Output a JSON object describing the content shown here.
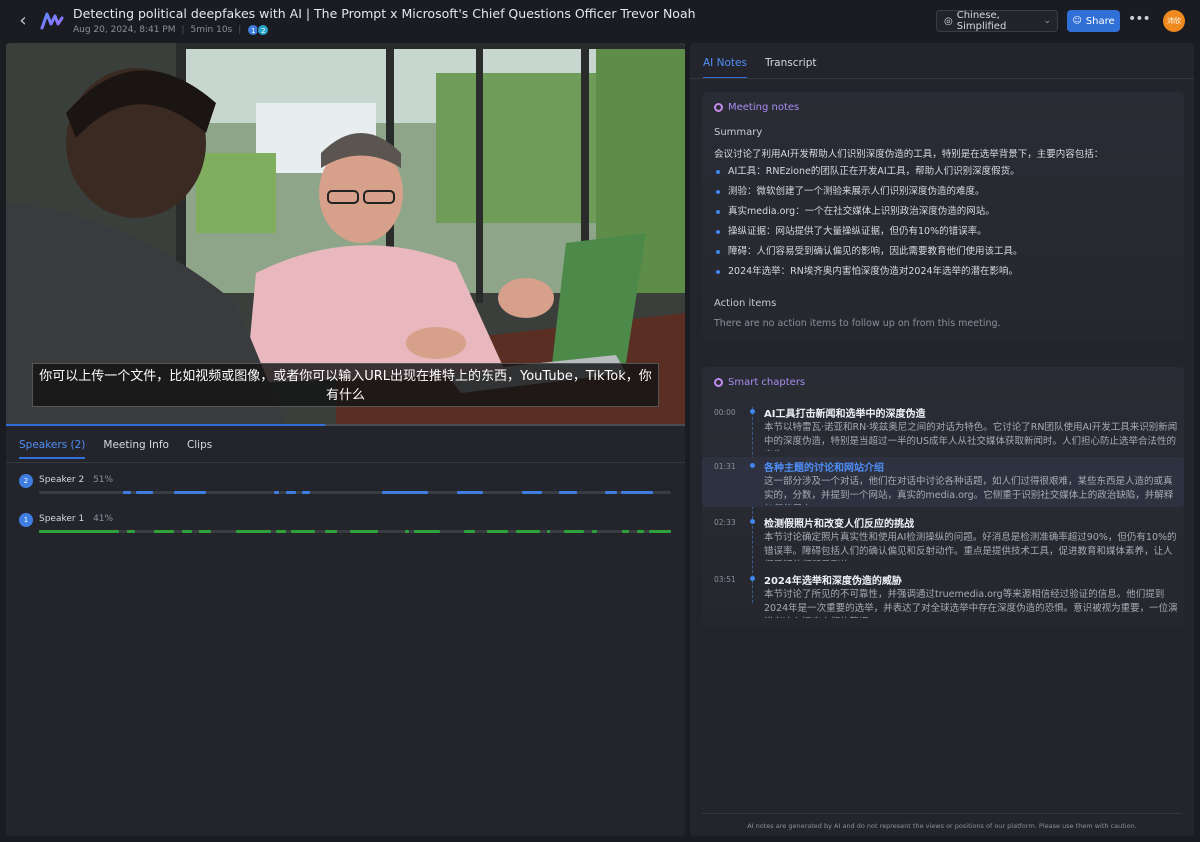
{
  "header": {
    "title": "Detecting political deepfakes with AI | The Prompt x Microsoft's Chief Questions Officer Trevor Noah",
    "date": "Aug 20, 2024, 8:41 PM",
    "duration": "5min 10s",
    "participants": [
      "1",
      "2"
    ],
    "language": "Chinese, Simplified",
    "share_label": "Share",
    "user_initials": "沛欣"
  },
  "video": {
    "subtitle": "你可以上传一个文件，比如视频或图像，或者你可以输入URL出现在推特上的东西，YouTube，TikTok，你有什么",
    "progress_fraction": 0.47
  },
  "left_tabs": [
    "Speakers (2)",
    "Meeting Info",
    "Clips"
  ],
  "speakers": [
    {
      "id": "2",
      "name": "Speaker 2",
      "pct": "51%",
      "color": "#3f7de0"
    },
    {
      "id": "1",
      "name": "Speaker 1",
      "pct": "41%",
      "color": "#2fa33a"
    }
  ],
  "right_tabs": [
    "AI Notes",
    "Transcript"
  ],
  "meeting_notes": {
    "header": "Meeting notes",
    "summary_title": "Summary",
    "summary_intro": "会议讨论了利用AI开发帮助人们识别深度伪造的工具，特别是在选举背景下，主要内容包括：",
    "bullets": [
      "AI工具：RNEzione的团队正在开发AI工具，帮助人们识别深度假货。",
      "测验：微软创建了一个测验来展示人们识别深度伪造的难度。",
      "真实media.org：一个在社交媒体上识别政治深度伪造的网站。",
      "操纵证据：网站提供了大量操纵证据，但仍有10%的错误率。",
      "障碍：人们容易受到确认偏见的影响，因此需要教育他们使用该工具。",
      "2024年选举：RN埃齐奥内害怕深度伪造对2024年选举的潜在影响。"
    ],
    "action_items_title": "Action items",
    "action_items_empty": "There are no action items to follow up on from this meeting."
  },
  "smart_chapters": {
    "header": "Smart chapters",
    "chapters": [
      {
        "time": "00:00",
        "title": "AI工具打击新闻和选举中的深度伪造",
        "desc": "本节以特雷瓦·诺亚和RN·埃兹奥尼之间的对话为特色。它讨论了RN团队使用AI开发工具来识别新闻中的深度伪造，特别是当超过一半的US成年人从社交媒体获取新闻时。人们担心防止选举合法性的丧失。"
      },
      {
        "time": "01:31",
        "title": "各种主题的讨论和网站介绍",
        "desc": "这一部分涉及一个对话，他们在对话中讨论各种话题，如人们过得很艰难，某些东西是人造的或真实的，分数，并提到一个网站，真实的media.org。它侧重于识别社交媒体上的政治缺陷，并解释如何使用它。"
      },
      {
        "time": "02:33",
        "title": "检测假照片和改变人们反应的挑战",
        "desc": "本节讨论确定照片真实性和使用AI检测操纵的问题。好消息是检测准确率超过90%，但仍有10%的错误率。障碍包括人们的确认偏见和反射动作。重点是提供技术工具，促进教育和媒体素养，让人们质疑他们所看到的。"
      },
      {
        "time": "03:51",
        "title": "2024年选举和深度伪造的威胁",
        "desc": "本节讨论了所见的不可靠性，并强调通过truemedia.org等来源相信经过验证的信息。他们提到2024年是一次重要的选举，并表达了对全球选举中存在深度伪造的恐惧。意识被视为重要，一位演讲者决心提高人们的警惕。"
      }
    ]
  },
  "footer": {
    "disclaimer": "AI notes are generated by AI and do not represent the views or positions of our platform. Please use them with caution."
  },
  "colors": {
    "accent": "#2f6fd6",
    "speaker1": "#2fa33a",
    "speaker2": "#3f7de0",
    "user_avatar": "#f08a1f"
  },
  "icons": [
    "back-arrow-icon",
    "app-logo-icon",
    "globe-icon",
    "chevron-down-icon",
    "share-icon",
    "more-icon"
  ]
}
